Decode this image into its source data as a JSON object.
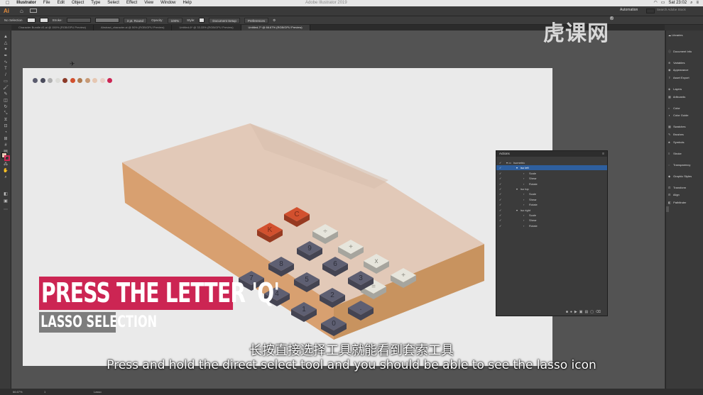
{
  "menubar": {
    "app": "Illustrator",
    "items": [
      "File",
      "Edit",
      "Object",
      "Type",
      "Select",
      "Effect",
      "View",
      "Window",
      "Help"
    ],
    "window_title": "Adobe Illustrator 2019",
    "clock": "Sat 23:02"
  },
  "apptop": {
    "workspace": "Automation",
    "search_placeholder": "Search Adobe Stock"
  },
  "control": {
    "selection": "No Selection",
    "stroke_label": "Stroke:",
    "brush": "3 pt. Round",
    "opacity_label": "Opacity:",
    "opacity_value": "100%",
    "style_label": "Style:",
    "document_setup": "Document Setup",
    "preferences": "Preferences"
  },
  "tabs": [
    {
      "label": "Character Bundle #1.ai @ 150% (RGB/GPU Preview)"
    },
    {
      "label": "Abstract_character.ai @ 50% (RGB/GPU Preview)"
    },
    {
      "label": "Untitled-6* @ 33.33% (RGB/GPU Preview)"
    },
    {
      "label": "Untitled-7* @ 66.67% (RGB/GPU Preview)"
    }
  ],
  "palette": [
    "#5b5c6e",
    "#4a4b5c",
    "#b0b0b0",
    "#dcdcd8",
    "#8c3a28",
    "#d2502e",
    "#b07a4f",
    "#c79a76",
    "#e6c7b2",
    "#e9cfc7",
    "#cc2553"
  ],
  "calculator": {
    "keys": [
      {
        "label": "K",
        "type": "orange"
      },
      {
        "label": "C",
        "type": "orange"
      },
      {
        "label": "÷",
        "type": "light"
      },
      {
        "label": "+",
        "type": "light"
      },
      {
        "label": "x",
        "type": "light"
      },
      {
        "label": "+",
        "type": "light"
      },
      {
        "label": "=",
        "type": "light"
      },
      {
        "label": "9",
        "type": "dark"
      },
      {
        "label": "6",
        "type": "dark"
      },
      {
        "label": "3",
        "type": "dark"
      },
      {
        "label": "8",
        "type": "dark"
      },
      {
        "label": "5",
        "type": "dark"
      },
      {
        "label": "2",
        "type": "dark"
      },
      {
        "label": "7",
        "type": "dark"
      },
      {
        "label": "4",
        "type": "dark"
      },
      {
        "label": "1",
        "type": "dark"
      },
      {
        "label": "0",
        "type": "dark"
      },
      {
        "label": ".",
        "type": "dark"
      }
    ],
    "colors": {
      "top": "#e2c9b8",
      "left": "#d8a070",
      "front": "#c8935f",
      "orange": "#d2502e",
      "light": "#e6e5dc",
      "dark": "#5e5f72"
    }
  },
  "overlay": {
    "title": "PRESS THE LETTER 'Q'",
    "subtitle": "LASSO SELECTION"
  },
  "actions_panel": {
    "title": "Actions",
    "rows": [
      {
        "label": "Isometric",
        "level": 0
      },
      {
        "label": "iso left",
        "level": 1,
        "selected": true
      },
      {
        "label": "Scale",
        "level": 2
      },
      {
        "label": "Shear",
        "level": 2
      },
      {
        "label": "Rotate",
        "level": 2
      },
      {
        "label": "iso top",
        "level": 1
      },
      {
        "label": "Scale",
        "level": 2
      },
      {
        "label": "Shear",
        "level": 2
      },
      {
        "label": "Rotate",
        "level": 2
      },
      {
        "label": "iso right",
        "level": 1
      },
      {
        "label": "Scale",
        "level": 2
      },
      {
        "label": "Shear",
        "level": 2
      },
      {
        "label": "Rotate",
        "level": 2
      }
    ]
  },
  "right_dock": [
    {
      "label": "Libraries",
      "icon": "libraries-icon"
    },
    {
      "label": "Document Info",
      "icon": "info-icon"
    },
    {
      "label": "Variables",
      "icon": "variables-icon"
    },
    {
      "label": "Appearance",
      "icon": "appearance-icon"
    },
    {
      "label": "Asset Export",
      "icon": "export-icon"
    },
    {
      "label": "Layers",
      "icon": "layers-icon"
    },
    {
      "label": "Artboards",
      "icon": "artboards-icon"
    },
    {
      "label": "Color",
      "icon": "color-icon"
    },
    {
      "label": "Color Guide",
      "icon": "color-guide-icon"
    },
    {
      "label": "Swatches",
      "icon": "swatches-icon"
    },
    {
      "label": "Brushes",
      "icon": "brushes-icon"
    },
    {
      "label": "Symbols",
      "icon": "symbols-icon"
    },
    {
      "label": "Stroke",
      "icon": "stroke-icon"
    },
    {
      "label": "Transparency",
      "icon": "transparency-icon"
    },
    {
      "label": "Graphic Styles",
      "icon": "graphic-styles-icon"
    },
    {
      "label": "Transform",
      "icon": "transform-icon"
    },
    {
      "label": "Align",
      "icon": "align-icon"
    },
    {
      "label": "Pathfinder",
      "icon": "pathfinder-icon"
    }
  ],
  "status": {
    "zoom": "66.67%",
    "artboard": "1",
    "tool": "Lasso"
  },
  "watermark": "虎课网",
  "subtitles": {
    "cn": "长按直接选择工具就能看到套索工具",
    "en": "Press and hold the direct select tool and you should be able to see the lasso icon"
  }
}
